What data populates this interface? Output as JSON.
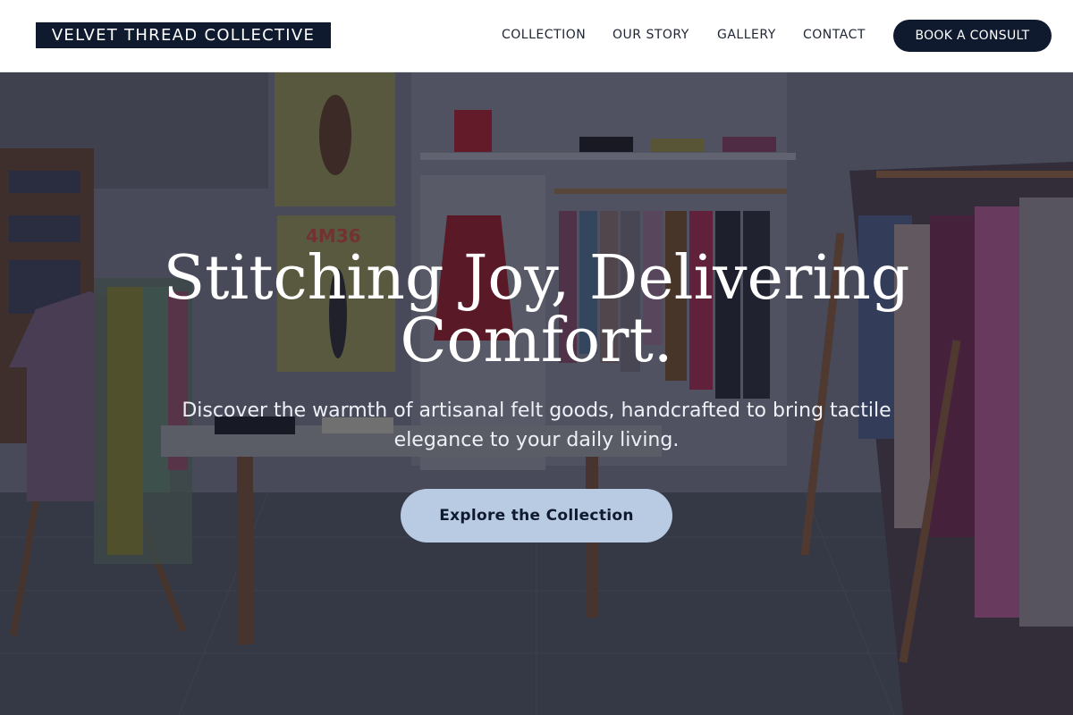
{
  "brand": {
    "name": "VELVET THREAD COLLECTIVE"
  },
  "nav": {
    "links": [
      "COLLECTION",
      "OUR STORY",
      "GALLERY",
      "CONTACT"
    ],
    "cta_label": "BOOK A CONSULT"
  },
  "hero": {
    "headline": "Stitching Joy, Delivering Comfort.",
    "subtitle": "Discover the warmth of artisanal felt goods, handcrafted to bring tactile elegance to your daily living.",
    "cta_label": "Explore the Collection",
    "poster_label": "4M36"
  },
  "colors": {
    "navy": "#0f1a2e",
    "cta_light_blue": "#b9cbe3",
    "white": "#ffffff"
  }
}
